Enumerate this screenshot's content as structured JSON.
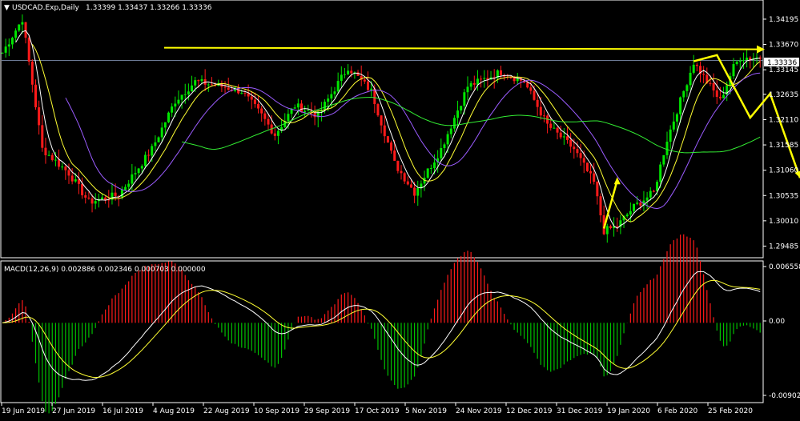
{
  "chart_data": [
    {
      "type": "candlestick",
      "symbol_header": "USDCAD.Exp,Daily",
      "ohlc_header": "1.33399 1.33437 1.33266 1.33336",
      "last_price_label": "1.33336",
      "y_ticks": [
        "1.34195",
        "1.33670",
        "1.33145",
        "1.32635",
        "1.32110",
        "1.31585",
        "1.31060",
        "1.30535",
        "1.30010",
        "1.29485"
      ],
      "ylim": [
        1.2931,
        1.3446
      ],
      "x_tick_labels": [
        "19 Jun 2019",
        "27 Jun 2019",
        "16 Jul 2019",
        "4 Aug 2019",
        "22 Aug 2019",
        "10 Sep 2019",
        "29 Sep 2019",
        "17 Oct 2019",
        "5 Nov 2019",
        "24 Nov 2019",
        "12 Dec 2019",
        "31 Dec 2019",
        "19 Jan 2020",
        "6 Feb 2020",
        "25 Feb 2020"
      ],
      "anchors": [
        [
          0,
          1.335
        ],
        [
          6,
          1.342
        ],
        [
          12,
          1.315
        ],
        [
          20,
          1.31
        ],
        [
          26,
          1.304
        ],
        [
          35,
          1.3055
        ],
        [
          45,
          1.315
        ],
        [
          52,
          1.325
        ],
        [
          58,
          1.329
        ],
        [
          66,
          1.328
        ],
        [
          72,
          1.327
        ],
        [
          78,
          1.322
        ],
        [
          82,
          1.318
        ],
        [
          88,
          1.324
        ],
        [
          95,
          1.322
        ],
        [
          104,
          1.332
        ],
        [
          111,
          1.327
        ],
        [
          118,
          1.312
        ],
        [
          124,
          1.306
        ],
        [
          132,
          1.315
        ],
        [
          140,
          1.328
        ],
        [
          150,
          1.331
        ],
        [
          157,
          1.329
        ],
        [
          164,
          1.32
        ],
        [
          172,
          1.315
        ],
        [
          178,
          1.308
        ],
        [
          181,
          1.298
        ],
        [
          185,
          1.299
        ],
        [
          190,
          1.303
        ],
        [
          196,
          1.306
        ],
        [
          200,
          1.317
        ],
        [
          208,
          1.333
        ],
        [
          213,
          1.328
        ],
        [
          216,
          1.325
        ],
        [
          220,
          1.332
        ],
        [
          222,
          1.334
        ]
      ],
      "ma_periods": [
        5,
        10,
        20,
        55
      ],
      "ma_colors": [
        "#ffffff",
        "#ffff33",
        "#9b5cff",
        "#33ee33"
      ],
      "bull_color": "#00e600",
      "bear_color": "#ff1a1a",
      "resistance_level": 1.3357,
      "projection_path": [
        [
          208,
          1.3332
        ],
        [
          215,
          1.3345
        ],
        [
          225,
          1.3215
        ],
        [
          231,
          1.3265
        ],
        [
          240,
          1.309
        ]
      ]
    },
    {
      "type": "macd",
      "title": "MACD(12,26,9) 0.002886 0.002346 0.000703 0.000000",
      "y_ticks": [
        "0.006558",
        "0.00",
        "-0.00902"
      ],
      "ylim": [
        -0.00902,
        0.006558
      ],
      "fast": 12,
      "slow": 26,
      "signal": 9
    }
  ]
}
